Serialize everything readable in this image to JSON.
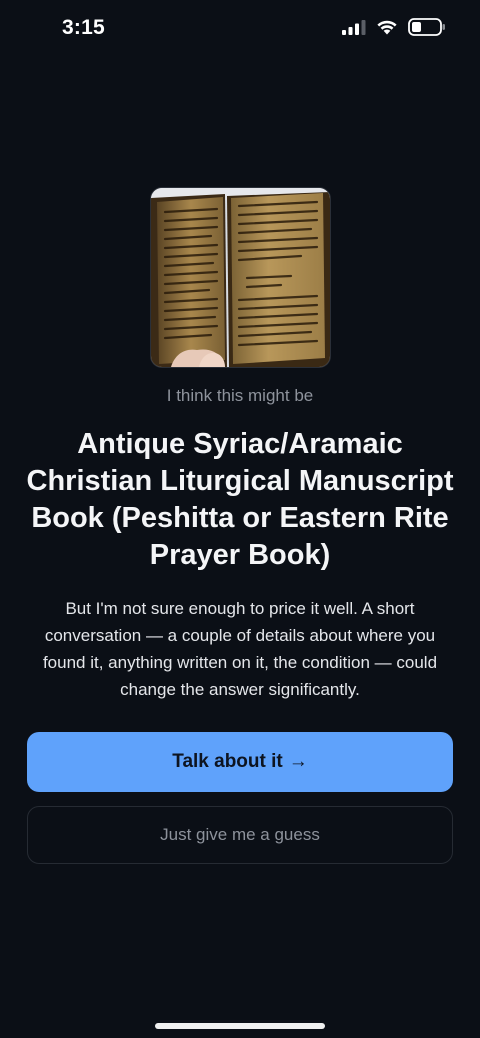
{
  "status_bar": {
    "time": "3:15",
    "icons": [
      "cellular-signal-icon",
      "wifi-icon",
      "battery-icon"
    ]
  },
  "hero": {
    "image_subject": "open antique manuscript book held in hand"
  },
  "identification": {
    "eyebrow": "I think this might be",
    "title": "Antique Syriac/Aramaic Christian Liturgical Manuscript Book (Peshitta or Eastern Rite Prayer Book)",
    "description": "But I'm not sure enough to price it well. A short conversation — a couple of details about where you found it, anything written on it, the condition — could change the answer significantly."
  },
  "actions": {
    "primary_label": "Talk about it",
    "primary_icon": "arrow-right-icon",
    "primary_arrow": "→",
    "secondary_label": "Just give me a guess"
  },
  "colors": {
    "background": "#0b0f16",
    "primary_button": "#5fa2fb",
    "secondary_text": "#8d929b"
  }
}
